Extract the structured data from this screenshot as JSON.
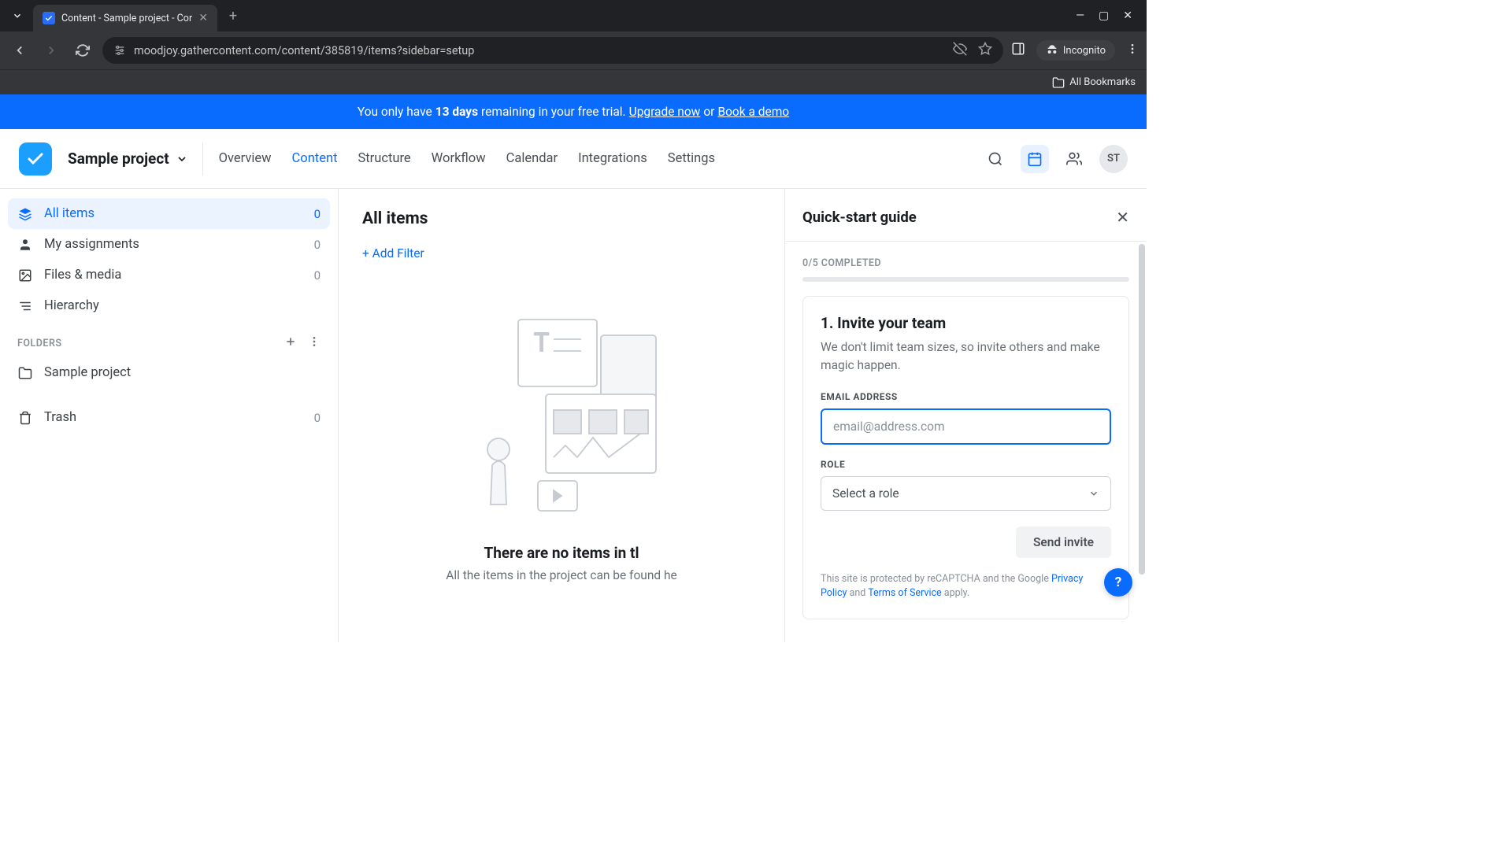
{
  "browser": {
    "tab_title": "Content - Sample project - Cor",
    "url": "moodjoy.gathercontent.com/content/385819/items?sidebar=setup",
    "incognito_label": "Incognito",
    "all_bookmarks": "All Bookmarks"
  },
  "banner": {
    "prefix": "You only have ",
    "days": "13 days",
    "mid": " remaining in your free trial. ",
    "upgrade": "Upgrade now",
    "or": " or ",
    "demo": "Book a demo"
  },
  "header": {
    "project_name": "Sample project",
    "tabs": [
      "Overview",
      "Content",
      "Structure",
      "Workflow",
      "Calendar",
      "Integrations",
      "Settings"
    ],
    "active_tab": "Content",
    "avatar_initials": "ST"
  },
  "sidebar": {
    "items": [
      {
        "label": "All items",
        "count": "0"
      },
      {
        "label": "My assignments",
        "count": "0"
      },
      {
        "label": "Files & media",
        "count": "0"
      },
      {
        "label": "Hierarchy",
        "count": ""
      }
    ],
    "folders_label": "FOLDERS",
    "folder_name": "Sample project",
    "trash_label": "Trash",
    "trash_count": "0"
  },
  "content": {
    "title": "All items",
    "add_filter": "+ Add Filter",
    "empty_title": "There are no items in tl",
    "empty_sub": "All the items in the project can be found he"
  },
  "qs": {
    "title": "Quick-start guide",
    "progress": "0/5 COMPLETED",
    "step_title": "1. Invite your team",
    "step_desc": "We don't limit team sizes, so invite others and make magic happen.",
    "email_label": "EMAIL ADDRESS",
    "email_placeholder": "email@address.com",
    "role_label": "ROLE",
    "role_placeholder": "Select a role",
    "send_label": "Send invite",
    "legal_prefix": "This site is protected by reCAPTCHA and the Google ",
    "legal_pp": "Privacy Policy",
    "legal_and": " and ",
    "legal_tos": "Terms of Service",
    "legal_suffix": " apply."
  }
}
